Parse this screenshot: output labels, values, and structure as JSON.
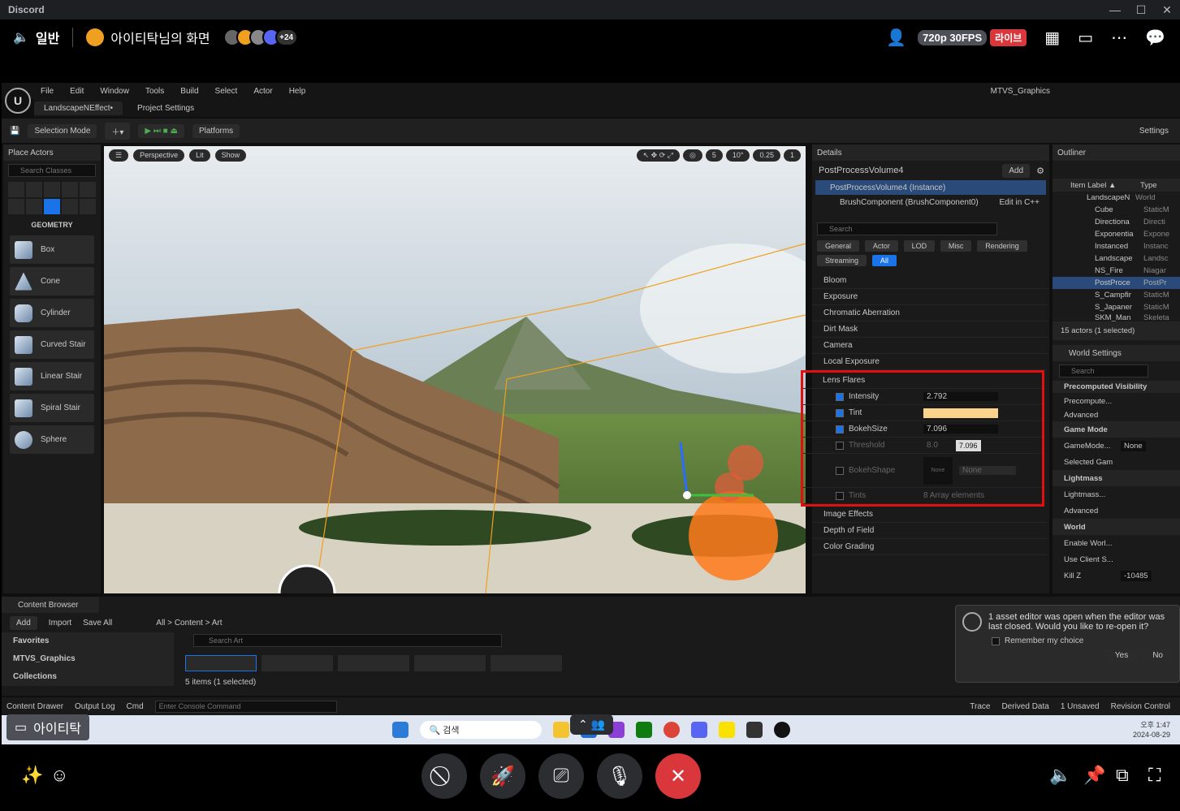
{
  "app_title": "Discord",
  "window_controls": [
    "—",
    "☐",
    "✕"
  ],
  "call": {
    "channel": "일반",
    "stream_title": "아이티탁님의 화면",
    "extra_viewers": "+24",
    "quality": "720p 30FPS",
    "live": "라이브"
  },
  "ue": {
    "project": "MTVS_Graphics",
    "menu": [
      "File",
      "Edit",
      "Window",
      "Tools",
      "Build",
      "Select",
      "Actor",
      "Help"
    ],
    "tabs": [
      "LandscapeNEffect•",
      "Project Settings"
    ],
    "toolbar": {
      "selection_mode": "Selection Mode",
      "platforms": "Platforms",
      "settings": "Settings"
    },
    "place_actors": {
      "title": "Place Actors",
      "search_placeholder": "Search Classes",
      "section": "GEOMETRY",
      "items": [
        "Box",
        "Cone",
        "Cylinder",
        "Curved Stair",
        "Linear Stair",
        "Spiral Stair",
        "Sphere"
      ]
    },
    "viewport": {
      "perspective": "Perspective",
      "lit": "Lit",
      "show": "Show",
      "grid": "5",
      "angle": "10°",
      "scale": "0.25",
      "cams": "1"
    },
    "details": {
      "title": "Details",
      "actor": "PostProcessVolume4",
      "add": "Add",
      "instance": "PostProcessVolume4 (Instance)",
      "component": "BrushComponent (BrushComponent0)",
      "edit_cpp": "Edit in C++",
      "search_placeholder": "Search",
      "categories": [
        "General",
        "Actor",
        "LOD",
        "Misc",
        "Rendering",
        "Streaming",
        "All"
      ],
      "sections": [
        "Bloom",
        "Exposure",
        "Chromatic Aberration",
        "Dirt Mask",
        "Camera",
        "Local Exposure",
        "Lens Flares"
      ],
      "props": {
        "intensity_label": "Intensity",
        "intensity_value": "2.792",
        "tint_label": "Tint",
        "bokehsize_label": "BokehSize",
        "bokehsize_value": "7.096",
        "threshold_label": "Threshold",
        "threshold_value": "8.0",
        "bokehshape_label": "BokehShape",
        "bokehshape_value": "None",
        "bokehshape_thumb": "None",
        "tints_label": "Tints",
        "tints_value": "8 Array elements"
      },
      "tooltip": "7.096",
      "after": [
        "Image Effects",
        "Depth of Field",
        "Color Grading"
      ]
    },
    "outliner": {
      "title": "Outliner",
      "col_label": "Item Label ▲",
      "col_type": "Type",
      "rows": [
        {
          "label": "LandscapeN",
          "type": "World"
        },
        {
          "label": "Cube",
          "type": "StaticM"
        },
        {
          "label": "Directiona",
          "type": "Directi"
        },
        {
          "label": "Exponentia",
          "type": "Expone"
        },
        {
          "label": "Instanced",
          "type": "Instanc"
        },
        {
          "label": "Landscape",
          "type": "Landsc"
        },
        {
          "label": "NS_Fire",
          "type": "Niagar"
        },
        {
          "label": "PostProce",
          "type": "PostPr"
        },
        {
          "label": "S_Campfir",
          "type": "StaticM"
        },
        {
          "label": "S_Japaner",
          "type": "StaticM"
        },
        {
          "label": "SKM_Man",
          "type": "Skeleta"
        }
      ],
      "count": "15 actors (1 selected)"
    },
    "world_settings": {
      "title": "World Settings",
      "search_placeholder": "Search",
      "rows": [
        "Precomputed Visibility",
        "Precompute...",
        "Advanced",
        "Game Mode",
        "GameMode...",
        "Selected Gam",
        "Lightmass",
        "Lightmass...",
        "Advanced",
        "World",
        "Enable Worl...",
        "Use Client S...",
        "Kill Z"
      ],
      "gamemode_value": "None",
      "killz_value": "-10485"
    },
    "content_browser": {
      "title": "Content Browser",
      "add": "Add",
      "import": "Import",
      "save_all": "Save All",
      "path": [
        "All",
        "Content",
        "Art"
      ],
      "favorites": "Favorites",
      "project": "MTVS_Graphics",
      "collections": "Collections",
      "search_placeholder": "Search Art",
      "items_count": "5 items (1 selected)"
    },
    "bottom": {
      "content_drawer": "Content Drawer",
      "output_log": "Output Log",
      "cmd": "Cmd",
      "console_placeholder": "Enter Console Command",
      "trace": "Trace",
      "derived": "Derived Data",
      "unsaved": "1 Unsaved",
      "revision": "Revision Control"
    },
    "toast": {
      "message": "1 asset editor was open when the editor was last closed. Would you like to re-open it?",
      "checkbox": "Remember my choice",
      "yes": "Yes",
      "no": "No"
    }
  },
  "taskbar": {
    "search": "검색",
    "time": "오후 1:47",
    "date": "2024-08-29"
  },
  "streamer_badge": "아이티탁"
}
